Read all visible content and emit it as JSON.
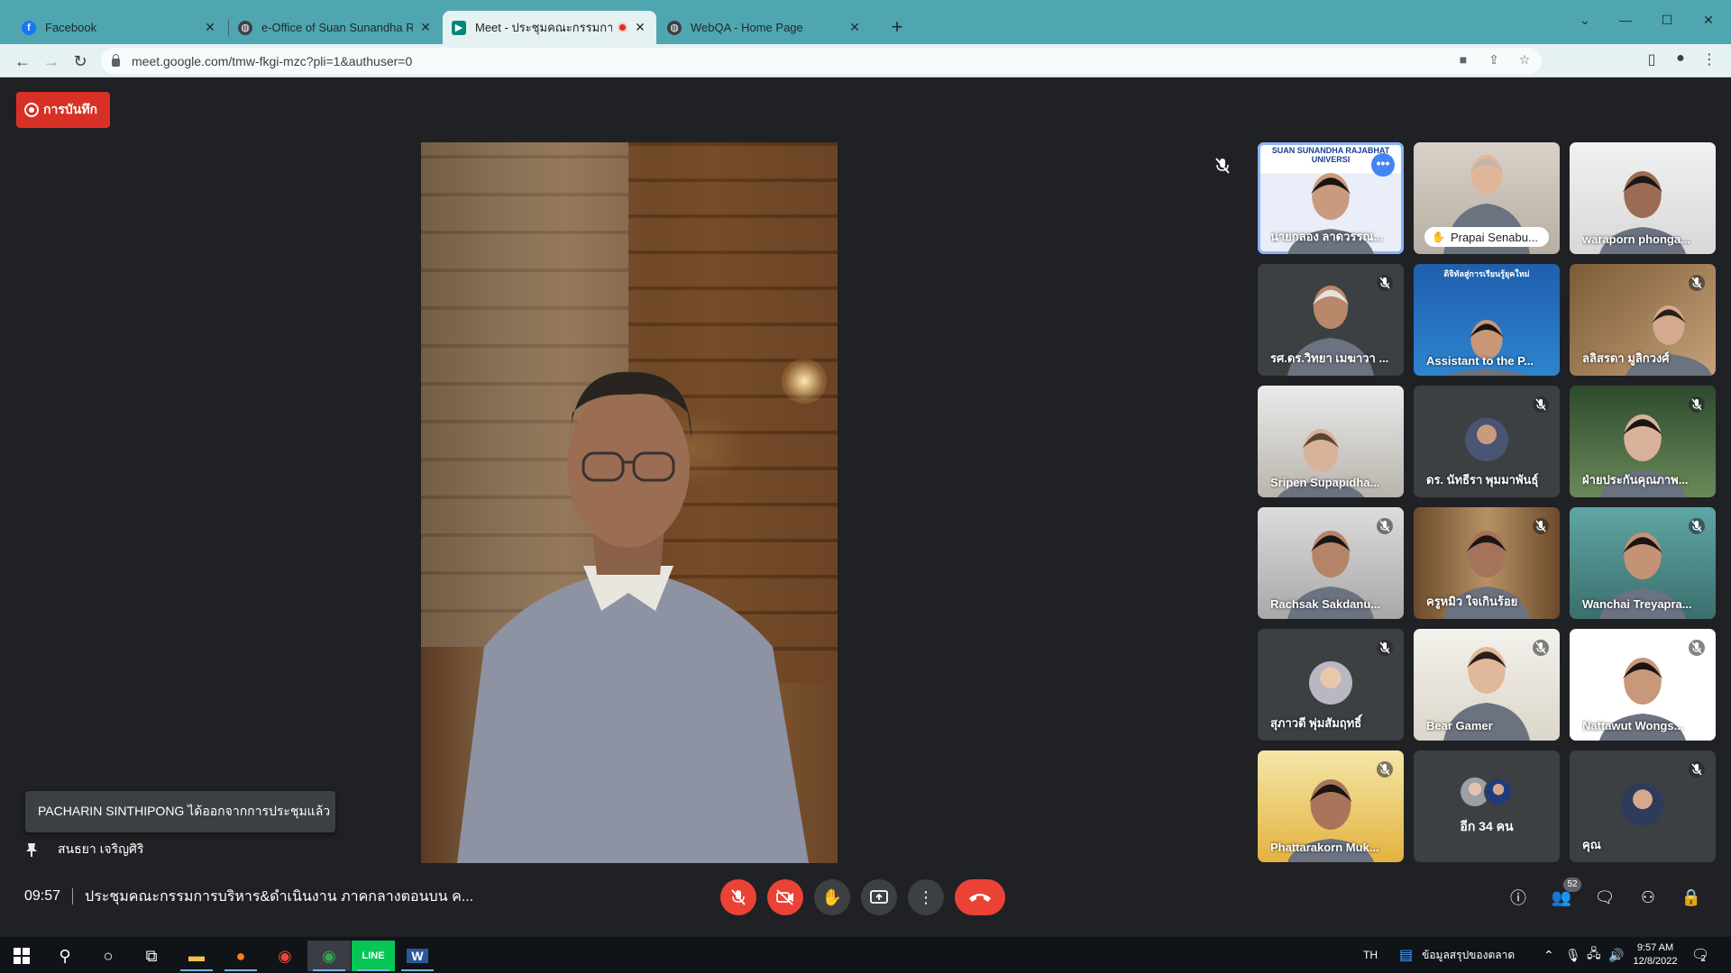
{
  "browser": {
    "tabs": [
      {
        "label": "Facebook",
        "favicon": "facebook-icon",
        "color": "#1877f2"
      },
      {
        "label": "e-Office of Suan Sunandha Rajab",
        "favicon": "globe-icon",
        "color": "#3c4043"
      },
      {
        "label": "Meet - ประชุมคณะกรรมการบริห",
        "favicon": "meet-icon",
        "color": "#00897b",
        "active": true,
        "recording": true
      },
      {
        "label": "WebQA - Home Page",
        "favicon": "globe-icon",
        "color": "#3c4043"
      }
    ],
    "url": "meet.google.com/tmw-fkgi-mzc?pli=1&authuser=0"
  },
  "meet": {
    "recording_label": "การบันทึก",
    "toast": "PACHARIN SINTHIPONG ได้ออกจากการประชุมแล้ว",
    "pinned_speaker": "สนธยา เจริญศิริ",
    "time": "09:57",
    "meeting_title": "ประชุมคณะกรรมการบริหาร&ดำเนินงาน ภาคกลางตอนบน ค...",
    "participant_count": "52",
    "tiles": [
      {
        "name": "นายกลอง ลาดวรรณ...",
        "banner": "SUAN SUNANDHA RAJABHAT UNIVERSI",
        "active": true
      },
      {
        "name": "Prapai Senabu...",
        "pill": true
      },
      {
        "name": "waraporn phonga..."
      },
      {
        "name": "รศ.ดร.วิทยา เมฆาวา ...",
        "muted": true
      },
      {
        "name": "Assistant to the P...",
        "banner": "ดิจิทัลสู่การเรียนรู้ยุคใหม่"
      },
      {
        "name": "ลลิสรดา มูลิกวงศ์",
        "muted": true
      },
      {
        "name": "Sripen Supapidha..."
      },
      {
        "name": "ดร. นัทธีรา พุมมาพันธุ์",
        "muted": true
      },
      {
        "name": "ฝ่ายประกันคุณภาพ...",
        "muted": true
      },
      {
        "name": "Rachsak Sakdanu...",
        "muted": true
      },
      {
        "name": "ครูหมิว ใจเกินร้อย",
        "muted": true
      },
      {
        "name": "Wanchai Treyapra...",
        "muted": true
      },
      {
        "name": "สุภาวดี พุ่มสัมฤทธิ์",
        "muted": true
      },
      {
        "name": "Bear Gamer",
        "muted": true
      },
      {
        "name": "Nattawut Wongs...",
        "muted": true
      },
      {
        "name": "Phattarakorn Muk...",
        "muted": true
      },
      {
        "name": "อีก 34 คน"
      },
      {
        "name": "คุณ",
        "muted": true
      }
    ]
  },
  "taskbar": {
    "lang": "TH",
    "news": "ข้อมูลสรุปของตลาด",
    "time": "9:57 AM",
    "date": "12/8/2022",
    "notifications": "2"
  }
}
